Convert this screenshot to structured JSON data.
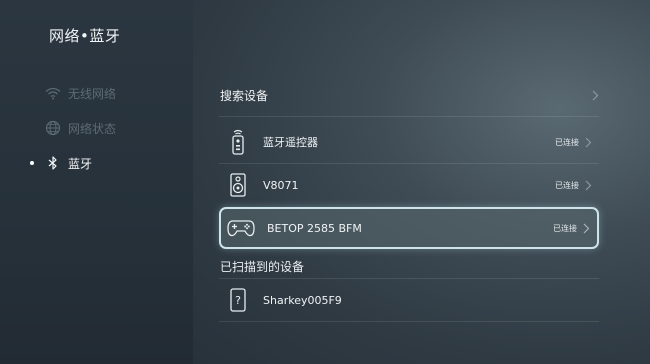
{
  "header": {
    "title": "网络•蓝牙"
  },
  "sidebar": {
    "items": [
      {
        "label": "无线网络",
        "icon": "wifi-icon",
        "state": "dim"
      },
      {
        "label": "网络状态",
        "icon": "globe-icon",
        "state": "dim"
      },
      {
        "label": "蓝牙",
        "icon": "bluetooth-icon",
        "state": "active"
      }
    ]
  },
  "main": {
    "search_label": "搜索设备",
    "paired_devices": [
      {
        "name": "蓝牙遥控器",
        "status": "已连接",
        "icon": "remote-icon"
      },
      {
        "name": "V8071",
        "status": "已连接",
        "icon": "speaker-icon"
      },
      {
        "name": "BETOP 2585 BFM",
        "status": "已连接",
        "icon": "gamepad-icon"
      }
    ],
    "scanned_label": "已扫描到的设备",
    "scanned_devices": [
      {
        "name": "Sharkey005F9",
        "icon": "unknown-device-icon"
      }
    ]
  },
  "colors": {
    "focus_border": "#cfe4ea",
    "text_primary": "#f0f3f5",
    "text_dim": "#5d6a74"
  }
}
